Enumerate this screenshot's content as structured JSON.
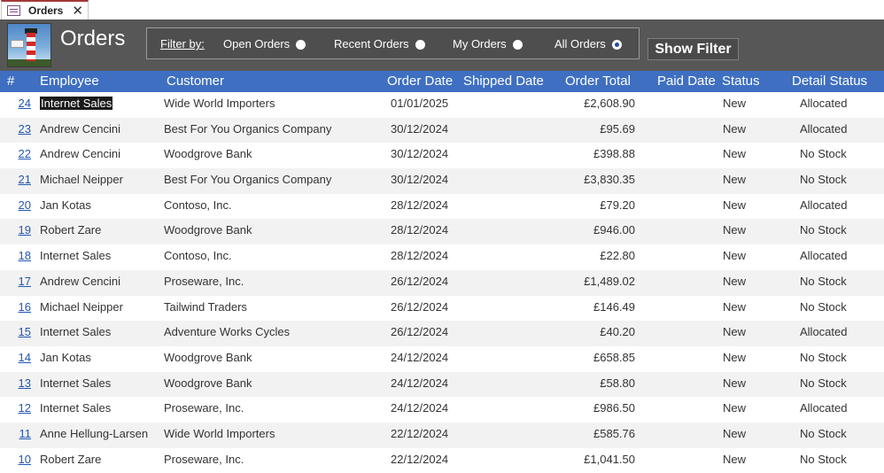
{
  "tab": {
    "label": "Orders",
    "close": "✕"
  },
  "header": {
    "title": "Orders",
    "filter_label": "Filter by:",
    "filter_options": [
      "Open Orders",
      "Recent Orders",
      "My Orders",
      "All Orders"
    ],
    "selected_filter": "All Orders",
    "show_filter_label": "Show Filter"
  },
  "columns": [
    "#",
    "Employee",
    "Customer",
    "Order Date",
    "Shipped Date",
    "Order Total",
    "Paid Date",
    "Status",
    "Detail Status"
  ],
  "orders": [
    {
      "id": "24",
      "employee": "Internet Sales",
      "customer": "Wide World Importers",
      "order_date": "01/01/2025",
      "shipped_date": "",
      "total": "£2,608.90",
      "paid_date": "",
      "status": "New",
      "detail_status": "Allocated"
    },
    {
      "id": "23",
      "employee": "Andrew Cencini",
      "customer": "Best For You Organics Company",
      "order_date": "30/12/2024",
      "shipped_date": "",
      "total": "£95.69",
      "paid_date": "",
      "status": "New",
      "detail_status": "Allocated"
    },
    {
      "id": "22",
      "employee": "Andrew Cencini",
      "customer": "Woodgrove Bank",
      "order_date": "30/12/2024",
      "shipped_date": "",
      "total": "£398.88",
      "paid_date": "",
      "status": "New",
      "detail_status": "No Stock"
    },
    {
      "id": "21",
      "employee": "Michael Neipper",
      "customer": "Best For You Organics Company",
      "order_date": "30/12/2024",
      "shipped_date": "",
      "total": "£3,830.35",
      "paid_date": "",
      "status": "New",
      "detail_status": "No Stock"
    },
    {
      "id": "20",
      "employee": "Jan Kotas",
      "customer": "Contoso, Inc.",
      "order_date": "28/12/2024",
      "shipped_date": "",
      "total": "£79.20",
      "paid_date": "",
      "status": "New",
      "detail_status": "Allocated"
    },
    {
      "id": "19",
      "employee": "Robert Zare",
      "customer": "Woodgrove Bank",
      "order_date": "28/12/2024",
      "shipped_date": "",
      "total": "£946.00",
      "paid_date": "",
      "status": "New",
      "detail_status": "No Stock"
    },
    {
      "id": "18",
      "employee": "Internet Sales",
      "customer": "Contoso, Inc.",
      "order_date": "28/12/2024",
      "shipped_date": "",
      "total": "£22.80",
      "paid_date": "",
      "status": "New",
      "detail_status": "Allocated"
    },
    {
      "id": "17",
      "employee": "Andrew Cencini",
      "customer": "Proseware, Inc.",
      "order_date": "26/12/2024",
      "shipped_date": "",
      "total": "£1,489.02",
      "paid_date": "",
      "status": "New",
      "detail_status": "No Stock"
    },
    {
      "id": "16",
      "employee": "Michael Neipper",
      "customer": "Tailwind Traders",
      "order_date": "26/12/2024",
      "shipped_date": "",
      "total": "£146.49",
      "paid_date": "",
      "status": "New",
      "detail_status": "No Stock"
    },
    {
      "id": "15",
      "employee": "Internet Sales",
      "customer": "Adventure Works Cycles",
      "order_date": "26/12/2024",
      "shipped_date": "",
      "total": "£40.20",
      "paid_date": "",
      "status": "New",
      "detail_status": "Allocated"
    },
    {
      "id": "14",
      "employee": "Jan Kotas",
      "customer": "Woodgrove Bank",
      "order_date": "24/12/2024",
      "shipped_date": "",
      "total": "£658.85",
      "paid_date": "",
      "status": "New",
      "detail_status": "No Stock"
    },
    {
      "id": "13",
      "employee": "Internet Sales",
      "customer": "Woodgrove Bank",
      "order_date": "24/12/2024",
      "shipped_date": "",
      "total": "£58.80",
      "paid_date": "",
      "status": "New",
      "detail_status": "No Stock"
    },
    {
      "id": "12",
      "employee": "Internet Sales",
      "customer": "Proseware, Inc.",
      "order_date": "24/12/2024",
      "shipped_date": "",
      "total": "£986.50",
      "paid_date": "",
      "status": "New",
      "detail_status": "Allocated"
    },
    {
      "id": "11",
      "employee": "Anne Hellung-Larsen",
      "customer": "Wide World Importers",
      "order_date": "22/12/2024",
      "shipped_date": "",
      "total": "£585.76",
      "paid_date": "",
      "status": "New",
      "detail_status": "No Stock"
    },
    {
      "id": "10",
      "employee": "Robert Zare",
      "customer": "Proseware, Inc.",
      "order_date": "22/12/2024",
      "shipped_date": "",
      "total": "£1,041.50",
      "paid_date": "",
      "status": "New",
      "detail_status": "No Stock"
    }
  ],
  "selected_row": 0,
  "colors": {
    "header_bg": "#575757",
    "column_header_bg": "#3f6fc1",
    "link": "#1f56b5",
    "selection": "#1a1a1a"
  }
}
